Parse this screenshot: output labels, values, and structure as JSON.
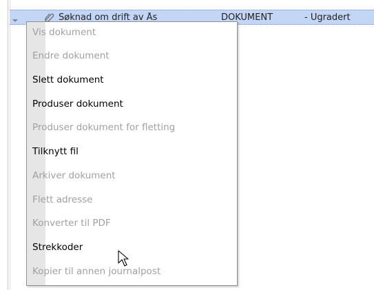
{
  "row": {
    "title": "Søknad om drift av Ås",
    "type": "DOKUMENT",
    "classification": "- Ugradert"
  },
  "context_menu": {
    "items": [
      {
        "label": "Vis dokument",
        "enabled": false
      },
      {
        "label": "Endre dokument",
        "enabled": false
      },
      {
        "label": "Slett dokument",
        "enabled": true
      },
      {
        "label": "Produser dokument",
        "enabled": true
      },
      {
        "label": "Produser dokument for fletting",
        "enabled": false
      },
      {
        "label": "Tilknytt fil",
        "enabled": true
      },
      {
        "label": "Arkiver dokument",
        "enabled": false
      },
      {
        "label": "Flett adresse",
        "enabled": false
      },
      {
        "label": "Konverter til PDF",
        "enabled": false
      },
      {
        "label": "Strekkoder",
        "enabled": true
      },
      {
        "label": "Kopier til annen journalpost",
        "enabled": false
      }
    ]
  },
  "icons": {
    "expander": "chevron-down-icon",
    "attachment": "paperclip-icon",
    "cursor": "mouse-pointer-icon"
  },
  "colors": {
    "row_highlight": "#c4d6f5",
    "enabled_text": "#000000",
    "disabled_text": "#a0a0a0"
  }
}
